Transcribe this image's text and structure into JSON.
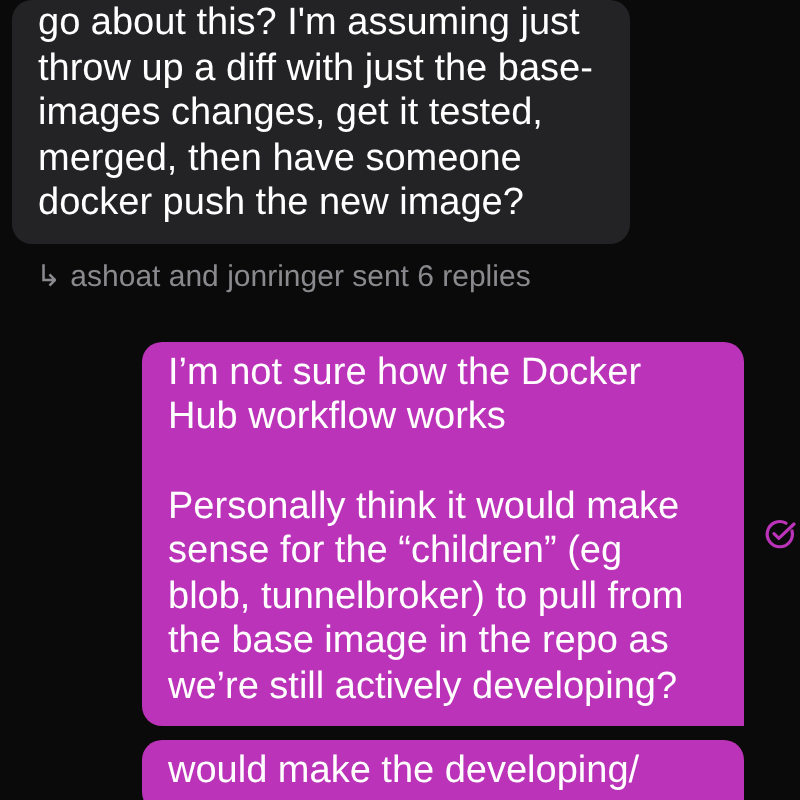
{
  "messages": [
    {
      "kind": "received",
      "paragraphs": [
        "go about this? I'm assuming just throw up a diff with just the base-images changes, get it tested, merged, then have someone docker push the new image?"
      ],
      "replies": "↳ ashoat and jonringer sent 6 replies"
    },
    {
      "kind": "sent",
      "paragraphs": [
        "I’m not sure how the Docker Hub workflow works",
        "Personally think it would make sense for the “children” (eg blob, tunnelbroker) to pull from the base image in the repo as we’re still actively developing?"
      ],
      "delivered": true
    },
    {
      "kind": "sent",
      "paragraphs": [
        "would make the developing/"
      ]
    }
  ]
}
